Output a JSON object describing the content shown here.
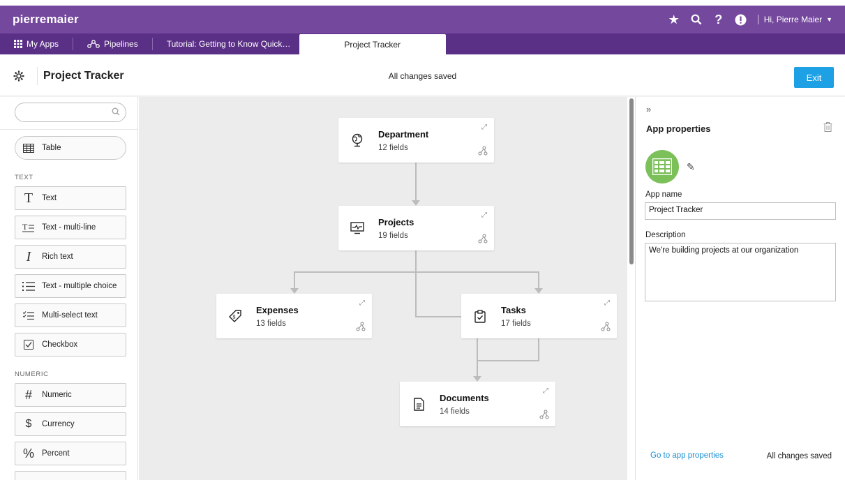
{
  "topbar": {
    "brand": "pierremaier",
    "user_label": "Hi, Pierre Maier",
    "icons": [
      "star-icon",
      "search-icon",
      "help-icon",
      "alert-icon"
    ]
  },
  "tabs": [
    {
      "label": "My Apps",
      "icon": "grid-icon"
    },
    {
      "label": "Pipelines",
      "icon": "pipelines-icon"
    },
    {
      "label": "Tutorial: Getting to Know Quick…"
    },
    {
      "label": "Project Tracker",
      "active": true
    }
  ],
  "header": {
    "title": "Project Tracker",
    "status": "All changes saved",
    "exit_label": "Exit"
  },
  "palette": {
    "search_placeholder": "",
    "table_label": "Table",
    "groups": {
      "text": "TEXT",
      "numeric": "NUMERIC"
    },
    "text_items": [
      {
        "label": "Text",
        "icon": "text-icon"
      },
      {
        "label": "Text - multi-line",
        "icon": "multiline-text-icon"
      },
      {
        "label": "Rich text",
        "icon": "rich-text-icon"
      },
      {
        "label": "Text - multiple choice",
        "icon": "list-icon"
      },
      {
        "label": "Multi-select text",
        "icon": "checklist-icon"
      },
      {
        "label": "Checkbox",
        "icon": "checkbox-icon"
      }
    ],
    "numeric_items": [
      {
        "label": "Numeric",
        "icon": "hash-icon"
      },
      {
        "label": "Currency",
        "icon": "dollar-icon"
      },
      {
        "label": "Percent",
        "icon": "percent-icon"
      }
    ]
  },
  "diagram": {
    "tables": [
      {
        "name": "Department",
        "fields": "12 fields",
        "icon": "globe-icon"
      },
      {
        "name": "Projects",
        "fields": "19 fields",
        "icon": "monitor-icon"
      },
      {
        "name": "Expenses",
        "fields": "13 fields",
        "icon": "tag-icon"
      },
      {
        "name": "Tasks",
        "fields": "17 fields",
        "icon": "clipboard-icon"
      },
      {
        "name": "Documents",
        "fields": "14 fields",
        "icon": "document-icon"
      }
    ]
  },
  "properties": {
    "title": "App properties",
    "app_name_label": "App name",
    "app_name_value": "Project Tracker",
    "description_label": "Description",
    "description_value": "We're building projects at our organization",
    "go_link": "Go to app properties",
    "status": "All changes saved",
    "icon_color": "#7cc05a"
  },
  "colors": {
    "topbar": "#74489d",
    "tabsbar": "#5a2f86",
    "accent": "#1ea0e4"
  }
}
